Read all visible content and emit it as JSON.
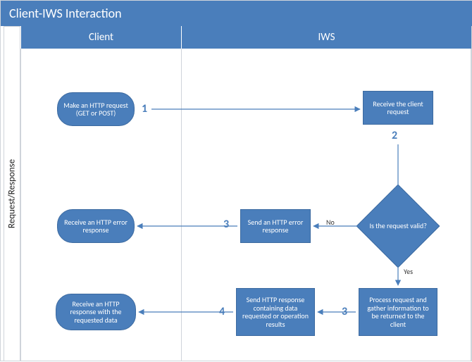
{
  "title": "Client-IWS Interaction",
  "swimlane_title": "Request/Response",
  "columns": {
    "client": "Client",
    "iws": "IWS"
  },
  "nodes": {
    "n1": "Make an HTTP request (GET or POST)",
    "n2": "Receive the client request",
    "n3": "Is the request valid?",
    "n4": "Send an HTTP error response",
    "n5": "Receive an HTTP error response",
    "n6": "Process request and gather information to be returned to the client",
    "n7": "Send HTTP response containing data requested or operation results",
    "n8": "Receive an HTTP response with the requested data"
  },
  "steps": {
    "s1": "1",
    "s2": "2",
    "s3a": "3",
    "s3b": "3",
    "s4": "4"
  },
  "edge_labels": {
    "no": "No",
    "yes": "Yes"
  }
}
